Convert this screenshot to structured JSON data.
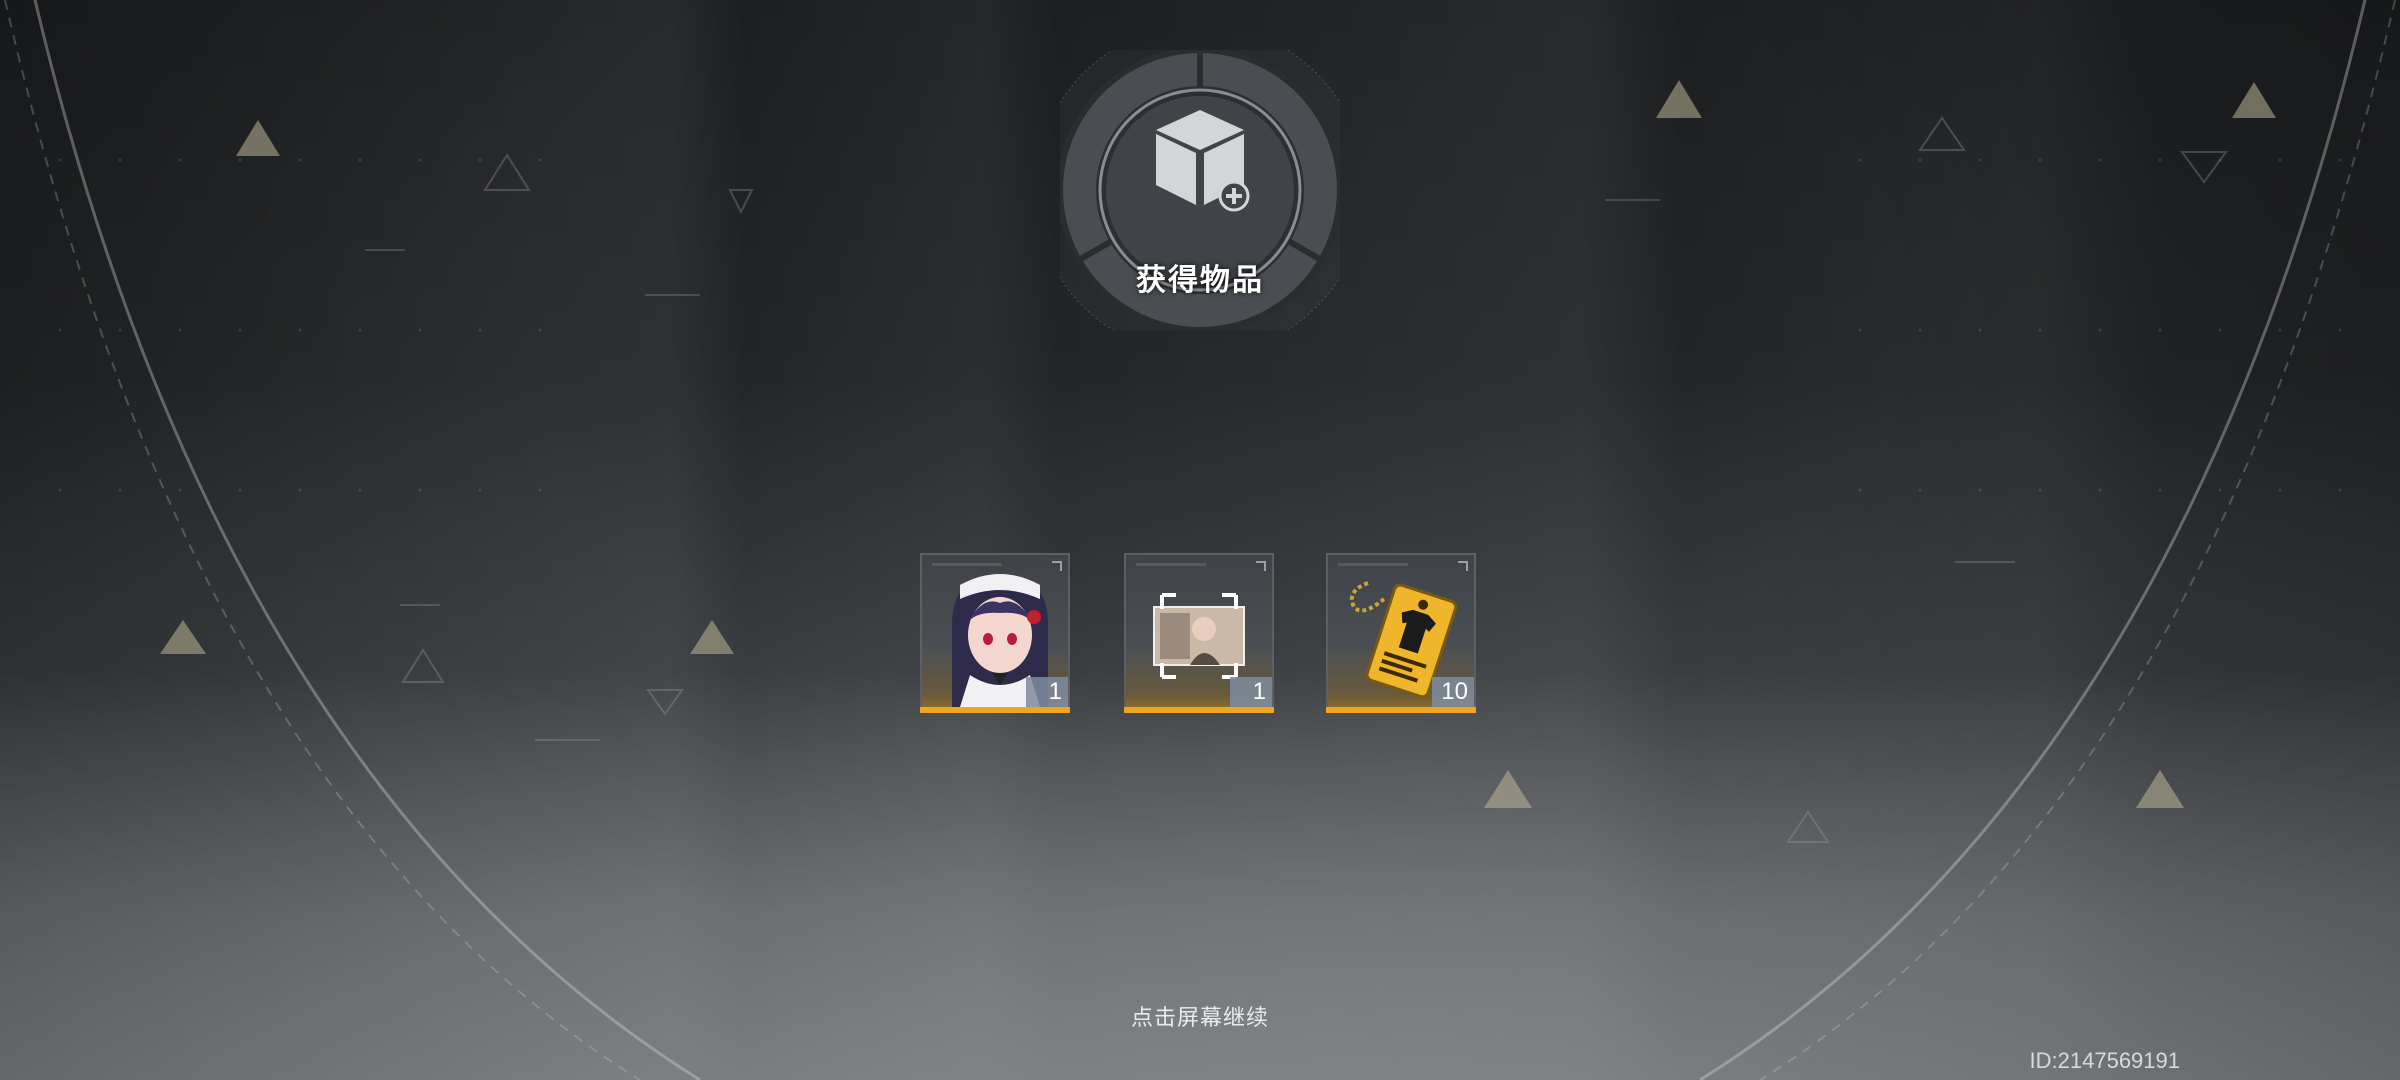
{
  "reward_panel": {
    "title": "获得物品",
    "continue_hint": "点击屏幕继续",
    "player_id": "ID:2147569191",
    "accent_color": "#f0a623",
    "items": [
      {
        "icon": "maid-character-portrait-icon",
        "quantity": "1"
      },
      {
        "icon": "photo-card-icon",
        "quantity": "1"
      },
      {
        "icon": "clothing-tag-keychain-icon",
        "quantity": "10"
      }
    ]
  }
}
